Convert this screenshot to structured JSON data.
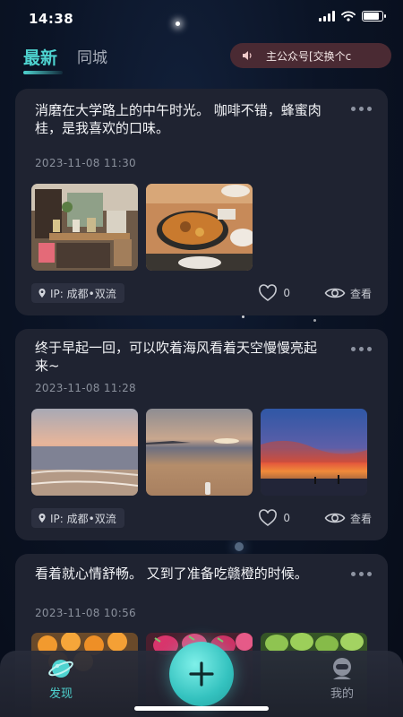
{
  "status_bar": {
    "time": "14:38"
  },
  "header": {
    "tabs": [
      {
        "label": "最新",
        "active": true
      },
      {
        "label": "同城",
        "active": false
      }
    ],
    "notice": "主公众号[交换个c"
  },
  "posts": [
    {
      "text": "消磨在大学路上的中午时光。 咖啡不错，蜂蜜肉桂，是我喜欢的口味。",
      "time": "2023-11-08 11:30",
      "ip": "IP: 成都•双流",
      "likes": "0",
      "view_label": "查看",
      "photos": [
        "cafe shelf interior",
        "restaurant soup bowl"
      ]
    },
    {
      "text": "终于早起一回，可以吹着海风看着天空慢慢亮起来~",
      "time": "2023-11-08 11:28",
      "ip": "IP: 成都•双流",
      "likes": "0",
      "view_label": "查看",
      "photos": [
        "sunrise beach",
        "calm sea beach",
        "red sunset sky"
      ]
    },
    {
      "text": "看着就心情舒畅。 又到了准备吃赣橙的时候。",
      "time": "2023-11-08 10:56",
      "photos": [
        "oranges",
        "dragon fruit",
        "green limes"
      ]
    }
  ],
  "bottom_nav": {
    "discover_label": "发现",
    "mine_label": "我的"
  },
  "colors": {
    "accent": "#4ed3d0",
    "card": "#1f2331",
    "background": "#0b1426"
  }
}
